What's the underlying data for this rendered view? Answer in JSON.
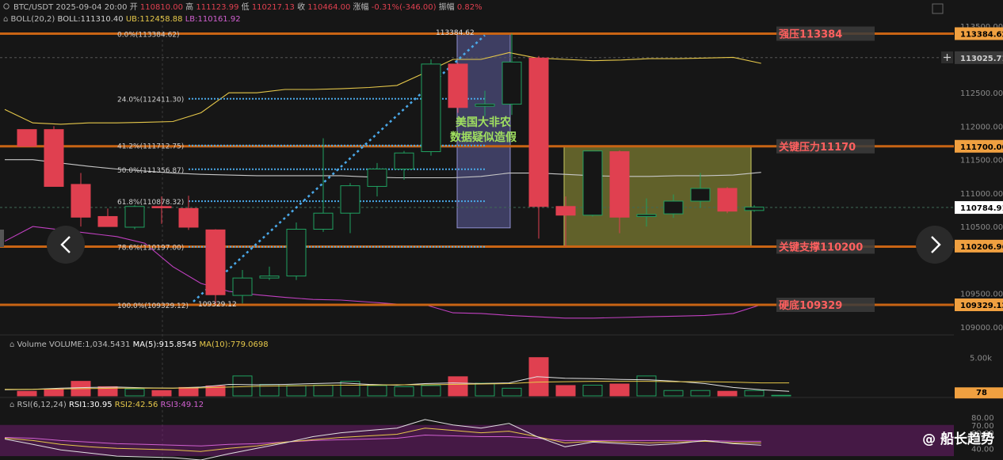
{
  "header": {
    "symbol": "BTC/USDT",
    "datetime": "2025-09-04 20:00",
    "open_label": "开",
    "open_value": "110810.00",
    "high_label": "高",
    "high_value": "111123.99",
    "low_label": "低",
    "low_value": "110217.13",
    "close_label": "收",
    "close_value": "110464.00",
    "change_label": "涨幅",
    "change_value": "-0.31%(-346.00)",
    "amplitude_label": "振幅",
    "amplitude_value": "0.82%"
  },
  "boll": {
    "name": "BOLL(20,2)",
    "mid": "BOLL:111310.40",
    "ub": "UB:112458.88",
    "lb": "LB:110161.92"
  },
  "price_axis": {
    "ticks": [
      {
        "price": 113500,
        "label": "113500.00"
      },
      {
        "price": 112500,
        "label": "112500.00"
      },
      {
        "price": 112000,
        "label": "112000.00"
      },
      {
        "price": 111500,
        "label": "111500.00"
      },
      {
        "price": 111000,
        "label": "111000.00"
      },
      {
        "price": 110500,
        "label": "110500.00"
      },
      {
        "price": 109500,
        "label": "109500.00"
      },
      {
        "price": 109000,
        "label": "109000.00"
      }
    ],
    "tags": [
      {
        "price": 113384.62,
        "label": "113384.62",
        "color": "#f0a040",
        "text": "#000000"
      },
      {
        "price": 113025.71,
        "label": "113025.71",
        "color": "#3a3a3a",
        "text": "#d0d0d0"
      },
      {
        "price": 111700,
        "label": "111700.00",
        "color": "#f0a040",
        "text": "#000000"
      },
      {
        "price": 110784.91,
        "label": "110784.91",
        "color": "#ffffff",
        "text": "#000000"
      },
      {
        "price": 110206.96,
        "label": "110206.96",
        "color": "#f0a040",
        "text": "#000000"
      },
      {
        "price": 109329.12,
        "label": "109329.12",
        "color": "#f0a040",
        "text": "#000000"
      }
    ]
  },
  "levels": [
    {
      "price": 113384.62,
      "label": "强压113384"
    },
    {
      "price": 111700,
      "label": "关键压力11170"
    },
    {
      "price": 110200,
      "label": "关键支撑110200"
    },
    {
      "price": 109329.12,
      "label": "硬底109329"
    }
  ],
  "fib": [
    {
      "label": "0.0%(113384.62)",
      "price": 113384.62
    },
    {
      "label": "24.0%(112411.30)",
      "price": 112411.3
    },
    {
      "label": "41.2%(111712.75)",
      "price": 111712.75
    },
    {
      "label": "50.0%(111356.87)",
      "price": 111356.87
    },
    {
      "label": "61.8%(110878.32)",
      "price": 110878.32
    },
    {
      "label": "78.6%(110197.00)",
      "price": 110197.0
    },
    {
      "label": "100.0%(109329.12)",
      "price": 109329.12
    }
  ],
  "annotations": {
    "high_marker": "113384.62",
    "low_marker": "109329.12",
    "nfp_line1": "美国大非农",
    "nfp_line2": "数据疑似造假"
  },
  "candles": [
    {
      "o": 111950,
      "h": 111950,
      "l": 111700,
      "c": 111700
    },
    {
      "o": 111950,
      "h": 112000,
      "l": 111100,
      "c": 111100
    },
    {
      "o": 111130,
      "h": 111300,
      "l": 110500,
      "c": 110640
    },
    {
      "o": 110650,
      "h": 110770,
      "l": 110500,
      "c": 110500
    },
    {
      "o": 110490,
      "h": 110820,
      "l": 110460,
      "c": 110800
    },
    {
      "o": 110800,
      "h": 110950,
      "l": 110540,
      "c": 110780
    },
    {
      "o": 110770,
      "h": 110960,
      "l": 110450,
      "c": 110490
    },
    {
      "o": 110450,
      "h": 110460,
      "l": 109329.12,
      "c": 109480
    },
    {
      "o": 109470,
      "h": 109850,
      "l": 109350,
      "c": 109730
    },
    {
      "o": 109730,
      "h": 109900,
      "l": 109700,
      "c": 109760
    },
    {
      "o": 109760,
      "h": 110560,
      "l": 109700,
      "c": 110460
    },
    {
      "o": 110460,
      "h": 111820,
      "l": 110420,
      "c": 110700
    },
    {
      "o": 110700,
      "h": 111150,
      "l": 110400,
      "c": 111110
    },
    {
      "o": 111100,
      "h": 111450,
      "l": 110950,
      "c": 111360
    },
    {
      "o": 111360,
      "h": 111630,
      "l": 111200,
      "c": 111600
    },
    {
      "o": 111620,
      "h": 113000,
      "l": 111560,
      "c": 112930
    },
    {
      "o": 112930,
      "h": 112950,
      "l": 112200,
      "c": 112280
    },
    {
      "o": 112300,
      "h": 112530,
      "l": 112150,
      "c": 112330
    },
    {
      "o": 112330,
      "h": 113384.62,
      "l": 112170,
      "c": 112960
    },
    {
      "o": 113020,
      "h": 113050,
      "l": 110320,
      "c": 110800
    },
    {
      "o": 110800,
      "h": 110950,
      "l": 110200,
      "c": 110670
    },
    {
      "o": 110670,
      "h": 111630,
      "l": 110650,
      "c": 111630
    },
    {
      "o": 111620,
      "h": 111640,
      "l": 110400,
      "c": 110640
    },
    {
      "o": 110650,
      "h": 110920,
      "l": 110500,
      "c": 110680
    },
    {
      "o": 110690,
      "h": 110980,
      "l": 110630,
      "c": 110880
    },
    {
      "o": 110880,
      "h": 111300,
      "l": 110780,
      "c": 111070
    },
    {
      "o": 111070,
      "h": 111090,
      "l": 110700,
      "c": 110730
    },
    {
      "o": 110740,
      "h": 110820,
      "l": 110720,
      "c": 110790
    }
  ],
  "boll_series": {
    "upper": [
      112250,
      112050,
      112030,
      112050,
      112050,
      112060,
      112070,
      112200,
      112500,
      112500,
      112550,
      112550,
      112560,
      112580,
      112610,
      112800,
      113000,
      113000,
      113100,
      113020,
      113000,
      112980,
      112990,
      113010,
      113010,
      113020,
      113030,
      112940
    ],
    "middle": [
      111500,
      111500,
      111450,
      111400,
      111360,
      111330,
      111300,
      111280,
      111270,
      111260,
      111260,
      111260,
      111260,
      111240,
      111230,
      111230,
      111230,
      111250,
      111300,
      111300,
      111280,
      111260,
      111250,
      111250,
      111260,
      111260,
      111270,
      111310
    ],
    "lower": [
      110280,
      110500,
      110450,
      110400,
      110350,
      110250,
      109900,
      109650,
      109530,
      109480,
      109440,
      109410,
      109400,
      109370,
      109340,
      109330,
      109210,
      109200,
      109170,
      109150,
      109130,
      109130,
      109140,
      109150,
      109160,
      109170,
      109200,
      109330
    ]
  },
  "volume": {
    "title": "Volume",
    "value_label": "VOLUME:1,034.5431",
    "ma5_label": "MA(5):915.8545",
    "ma10_label": "MA(10):779.0698",
    "axis_label": "5.00k",
    "current_tag": "78",
    "max": 6000,
    "bars": [
      600,
      900,
      1900,
      1200,
      900,
      700,
      1100,
      1300,
      2600,
      1500,
      1350,
      1400,
      1900,
      1350,
      1200,
      1350,
      2500,
      1650,
      1000,
      5000,
      1350,
      1400,
      1550,
      2600,
      700,
      700,
      600,
      700,
      78
    ],
    "ma5": [
      800,
      850,
      1000,
      1100,
      1150,
      1050,
      1000,
      1150,
      1500,
      1450,
      1500,
      1600,
      1700,
      1500,
      1400,
      1600,
      1700,
      1600,
      1700,
      2500,
      2300,
      2250,
      2150,
      2100,
      1900,
      1600,
      1100,
      800,
      600
    ],
    "ma10": [
      850,
      850,
      900,
      950,
      1000,
      1000,
      1000,
      1050,
      1150,
      1250,
      1300,
      1350,
      1400,
      1400,
      1450,
      1450,
      1500,
      1550,
      1600,
      1800,
      1850,
      1900,
      1900,
      1900,
      1850,
      1850,
      1800,
      1700,
      1700
    ]
  },
  "rsi": {
    "name": "RSI(6,12,24)",
    "rsi1": "RSI1:30.95",
    "rsi2": "RSI2:42.56",
    "rsi3": "RSI3:49.12",
    "axis": [
      {
        "v": 80,
        "label": "80.00"
      },
      {
        "v": 70,
        "label": "70.00"
      },
      {
        "v": 60,
        "label": "60.00"
      },
      {
        "v": 40,
        "label": "40.00"
      }
    ],
    "rsi1_series": [
      52,
      45,
      38,
      34,
      30,
      29,
      28,
      25,
      33,
      40,
      47,
      55,
      60,
      63,
      66,
      77,
      70,
      66,
      72,
      55,
      42,
      48,
      46,
      44,
      46,
      50,
      46,
      44
    ],
    "rsi2_series": [
      53,
      50,
      45,
      42,
      40,
      39,
      38,
      36,
      40,
      43,
      48,
      51,
      54,
      56,
      58,
      66,
      63,
      60,
      62,
      55,
      47,
      49,
      48,
      47,
      48,
      49,
      47,
      47
    ],
    "rsi3_series": [
      54,
      53,
      50,
      48,
      46,
      45,
      44,
      43,
      45,
      46,
      48,
      50,
      51,
      52,
      53,
      57,
      56,
      55,
      55,
      53,
      50,
      50,
      50,
      50,
      50,
      50,
      49,
      49
    ]
  },
  "watermark": "@ 船长趋势",
  "colors": {
    "up": "#20a060",
    "down": "#e04050",
    "level": "#c86414",
    "level_text": "#ff6060",
    "boll_upper": "#e6c84a",
    "boll_middle": "#c8c8c8",
    "boll_lower": "#c040c0",
    "fib": "#4aa8e8",
    "zone": "#8a8a30"
  }
}
